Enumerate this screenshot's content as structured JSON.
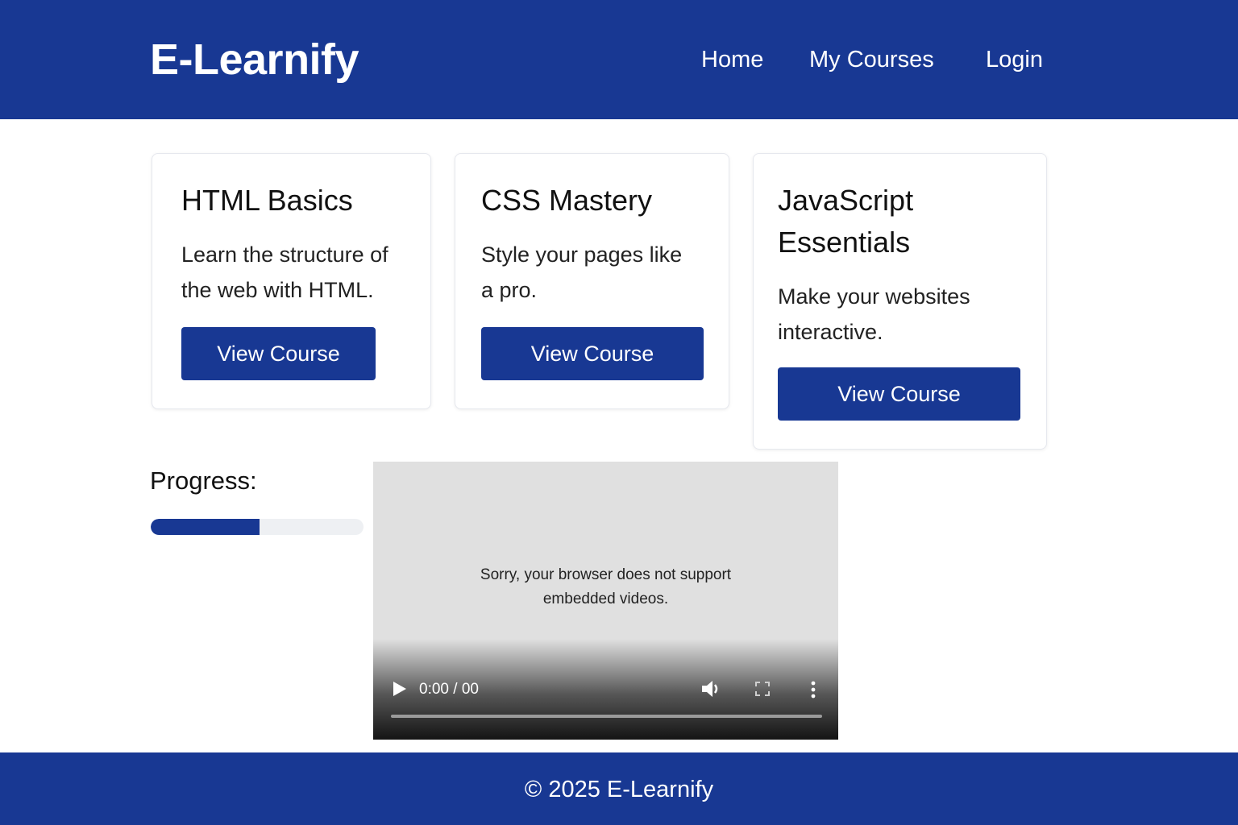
{
  "header": {
    "logo": "E-Learnify",
    "nav": [
      {
        "label": "Home"
      },
      {
        "label": "My Courses"
      },
      {
        "label": "Login"
      }
    ]
  },
  "courses": [
    {
      "title": "HTML Basics",
      "desc_lines": [
        "Learn the structure of",
        "the web with HTML."
      ],
      "button": "View Course"
    },
    {
      "title": "CSS Mastery",
      "desc_lines": [
        "Style your pages like",
        "a pro."
      ],
      "button": "View Course"
    },
    {
      "title_lines": [
        "JavaScript",
        "Essentials"
      ],
      "desc_lines": [
        "Make your websites",
        "interactive."
      ],
      "button": "View Course"
    }
  ],
  "progress": {
    "label": "Progress:",
    "percent": 51
  },
  "video": {
    "fallback_lines": [
      "Sorry, your browser does not support",
      "embedded videos."
    ],
    "time": "0:00 / 00",
    "icons": [
      "play-icon",
      "volume-icon",
      "fullscreen-icon",
      "more-options-icon"
    ]
  },
  "footer": {
    "text": "© 2025 E-Learnify"
  },
  "colors": {
    "brand": "#183893",
    "background": "#ffffff",
    "progress_track": "#eef0f3",
    "video_bg": "#e0e0e0"
  }
}
